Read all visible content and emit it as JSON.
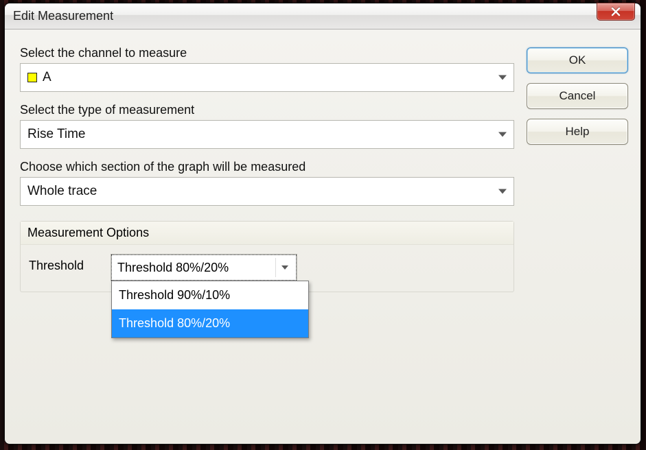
{
  "window": {
    "title": "Edit Measurement"
  },
  "buttons": {
    "ok": "OK",
    "cancel": "Cancel",
    "help": "Help"
  },
  "fields": {
    "channel_label": "Select the channel to measure",
    "channel_value": "A",
    "channel_color": "#ffff00",
    "type_label": "Select the type of measurement",
    "type_value": "Rise Time",
    "section_label": "Choose which section of the graph will be measured",
    "section_value": "Whole trace"
  },
  "options_group": {
    "title": "Measurement Options",
    "threshold_label": "Threshold",
    "threshold_value": "Threshold 80%/20%",
    "threshold_options": [
      "Threshold 90%/10%",
      "Threshold 80%/20%"
    ],
    "threshold_selected_index": 1
  }
}
